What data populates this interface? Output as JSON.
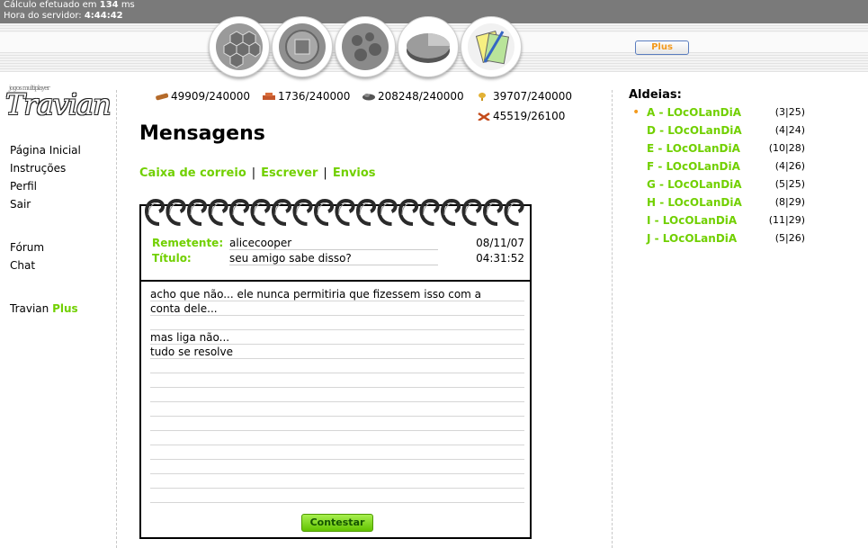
{
  "status": {
    "calc_prefix": "Cálculo efetuado em",
    "calc_value": "134",
    "calc_unit": "ms",
    "server_prefix": "Hora do servidor:",
    "server_time": "4:44:42"
  },
  "nav": {
    "icons": [
      "village-overview-icon",
      "village-center-icon",
      "map-icon",
      "statistics-icon",
      "reports-icon"
    ],
    "plus_label": "Plus"
  },
  "logo": {
    "small": "jogos multiplayer",
    "text": "Travian"
  },
  "sidebar": {
    "items": [
      {
        "label": "Página Inicial"
      },
      {
        "label": "Instruções"
      },
      {
        "label": "Perfil"
      },
      {
        "label": "Sair"
      },
      {
        "label": "Fórum"
      },
      {
        "label": "Chat"
      }
    ],
    "travian_label": "Travian",
    "plus_label": "Plus"
  },
  "resources": {
    "wood": "49909/240000",
    "clay": "1736/240000",
    "iron": "208248/240000",
    "crop": "39707/240000",
    "consumption": "45519/26100"
  },
  "page": {
    "title": "Mensagens",
    "tabs": [
      "Caixa de correio",
      "Escrever",
      "Envios"
    ],
    "tab_separator": "|"
  },
  "message": {
    "sender_label": "Remetente:",
    "sender": "alicecooper",
    "date": "08/11/07",
    "subject_label": "Título:",
    "subject": "seu amigo sabe disso?",
    "time": "04:31:52",
    "lines": [
      "acho que não... ele nunca permitiria que fizessem isso com a",
      "conta dele...",
      "",
      "mas liga não...",
      "tudo se resolve"
    ],
    "reply_button": "Contestar"
  },
  "villages": {
    "title": "Aldeias:",
    "items": [
      {
        "name": "A - LOcOLanDiA",
        "coords": "(3|25)",
        "active": true
      },
      {
        "name": "D - LOcOLanDiA",
        "coords": "(4|24)",
        "active": false
      },
      {
        "name": "E - LOcOLanDiA",
        "coords": "(10|28)",
        "active": false
      },
      {
        "name": "F - LOcOLanDiA",
        "coords": "(4|26)",
        "active": false
      },
      {
        "name": "G - LOcOLanDiA",
        "coords": "(5|25)",
        "active": false
      },
      {
        "name": "H - LOcOLanDiA",
        "coords": "(8|29)",
        "active": false
      },
      {
        "name": "I - LOcOLanDiA",
        "coords": "(11|29)",
        "active": false
      },
      {
        "name": "J - LOcOLanDiA",
        "coords": "(5|26)",
        "active": false
      }
    ]
  },
  "colors": {
    "link_green": "#71d000",
    "active_dot": "#f39a1e",
    "topbar": "#7a7a7a"
  }
}
